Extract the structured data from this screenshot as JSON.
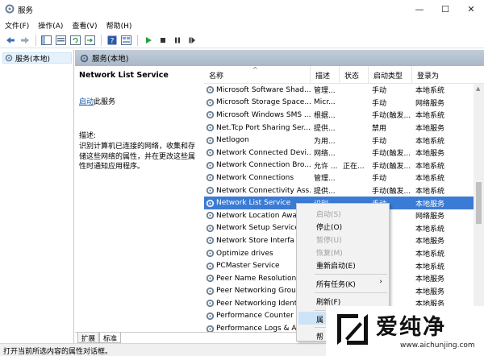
{
  "window": {
    "title": "服务",
    "minimize": "—",
    "maximize": "☐",
    "close": "✕"
  },
  "menu": [
    "文件(F)",
    "操作(A)",
    "查看(V)",
    "帮助(H)"
  ],
  "toolbar_icons": [
    "back-icon",
    "forward-icon",
    "show-tree-icon",
    "console-icon",
    "refresh-icon",
    "export-icon",
    "help-icon",
    "properties-icon",
    "play-icon",
    "stop-icon",
    "pause-icon",
    "restart-icon"
  ],
  "tree": {
    "root_label": "服务(本地)"
  },
  "pane": {
    "header": "服务(本地)",
    "selected_title": "Network List Service",
    "start_link": "启动",
    "start_suffix": "此服务",
    "desc_label": "描述:",
    "desc_text": "识别计算机已连接的网络，收集和存储这些网络的属性，并在更改这些属性时通知应用程序。"
  },
  "columns": [
    "名称",
    "描述",
    "状态",
    "启动类型",
    "登录为"
  ],
  "rows": [
    [
      "Microsoft Software Shad...",
      "管理...",
      "",
      "手动",
      "本地系统"
    ],
    [
      "Microsoft Storage Space...",
      "Micr...",
      "",
      "手动",
      "网络服务"
    ],
    [
      "Microsoft Windows SMS ...",
      "根据...",
      "",
      "手动(触发...",
      "本地系统"
    ],
    [
      "Net.Tcp Port Sharing Ser...",
      "提供...",
      "",
      "禁用",
      "本地服务"
    ],
    [
      "Netlogon",
      "为用...",
      "",
      "手动",
      "本地系统"
    ],
    [
      "Network Connected Devi...",
      "网络...",
      "",
      "手动(触发...",
      "本地服务"
    ],
    [
      "Network Connection Bro...",
      "允许 ...",
      "正在...",
      "手动(触发...",
      "本地系统"
    ],
    [
      "Network Connections",
      "管理...",
      "",
      "手动",
      "本地系统"
    ],
    [
      "Network Connectivity Ass...",
      "提供...",
      "",
      "手动(触发...",
      "本地系统"
    ],
    [
      "Network List Service",
      "识别...",
      "",
      "手动",
      "本地服务"
    ],
    [
      "Network Location Awa",
      "",
      "",
      "",
      "网络服务"
    ],
    [
      "Network Setup Service",
      "",
      "",
      "",
      "本地系统"
    ],
    [
      "Network Store Interfa",
      "",
      "",
      "",
      "本地服务"
    ],
    [
      "Optimize drives",
      "",
      "",
      "",
      "本地系统"
    ],
    [
      "PCMaster Service",
      "",
      "",
      "",
      "本地系统"
    ],
    [
      "Peer Name Resolution",
      "",
      "",
      "",
      "本地服务"
    ],
    [
      "Peer Networking Grou",
      "",
      "",
      "",
      "本地服务"
    ],
    [
      "Peer Networking Ident",
      "",
      "",
      "",
      "本地服务"
    ],
    [
      "Performance Counter I",
      "",
      "",
      "",
      "本地服务"
    ],
    [
      "Performance Logs & Al",
      "",
      "",
      "",
      "本地服务"
    ]
  ],
  "selected_row": 9,
  "context_menu": {
    "start": "启动(S)",
    "stop": "停止(O)",
    "pause": "暂停(U)",
    "resume": "恢复(M)",
    "restart": "重新启动(E)",
    "all_tasks": "所有任务(K)",
    "all_tasks_arrow": "›",
    "refresh": "刷新(F)",
    "properties": "属",
    "help": "帮"
  },
  "tabs": [
    "扩展",
    "标准"
  ],
  "status": "打开当前所选内容的属性对话框。",
  "watermark": {
    "text": "爱纯净",
    "url": "www.aichunjing.com"
  }
}
